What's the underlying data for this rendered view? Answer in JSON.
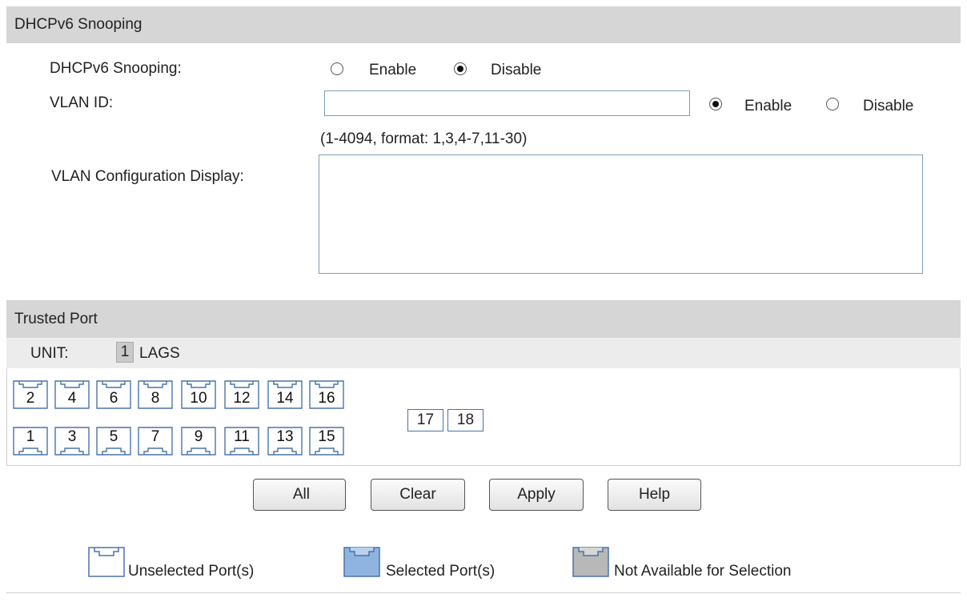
{
  "dhcp_section": {
    "title": "DHCPv6 Snooping",
    "snooping_label": "DHCPv6 Snooping:",
    "snooping_enable": "Enable",
    "snooping_disable": "Disable",
    "snooping_selected": "Disable",
    "vlan_id_label": "VLAN ID:",
    "vlan_id_value": "",
    "vlan_enable": "Enable",
    "vlan_disable": "Disable",
    "vlan_selected": "Enable",
    "vlan_hint": "(1-4094, format: 1,3,4-7,11-30)",
    "vlan_display_label": "VLAN Configuration Display:",
    "vlan_display_value": ""
  },
  "trusted_section": {
    "title": "Trusted Port",
    "unit_label": "UNIT:",
    "unit_value": "1",
    "lags_label": "LAGS",
    "top_ports": [
      "2",
      "4",
      "6",
      "8",
      "10",
      "12",
      "14",
      "16"
    ],
    "bottom_ports": [
      "1",
      "3",
      "5",
      "7",
      "9",
      "11",
      "13",
      "15"
    ],
    "sfp_ports": [
      "17",
      "18"
    ]
  },
  "buttons": {
    "all": "All",
    "clear": "Clear",
    "apply": "Apply",
    "help": "Help"
  },
  "legend": {
    "unselected": "Unselected Port(s)",
    "selected": "Selected Port(s)",
    "unavailable": "Not Available for Selection"
  },
  "colors": {
    "header_bg": "#d6d6d6",
    "port_border": "#4a74a8",
    "selected_fill": "#8fb4e0",
    "unavailable_fill": "#b8b8b8"
  }
}
